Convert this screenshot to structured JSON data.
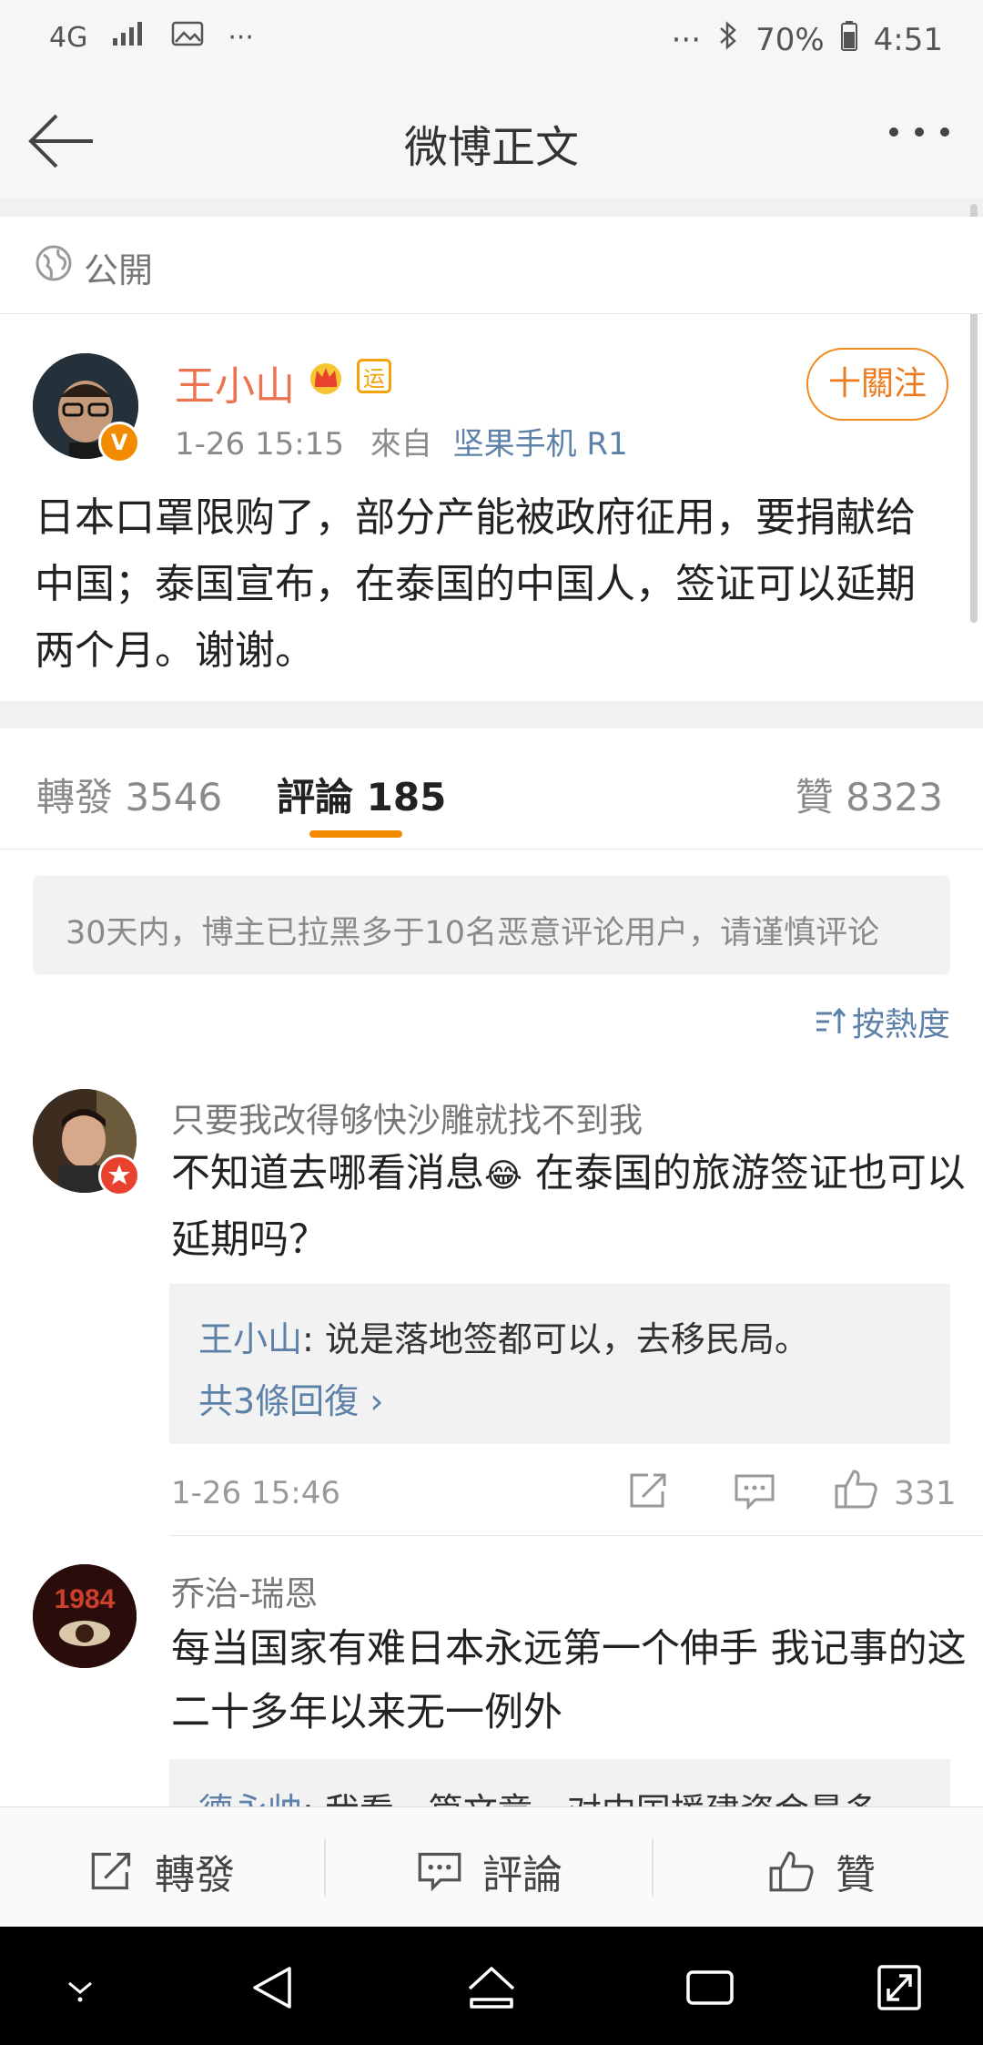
{
  "status_bar": {
    "network": "4G",
    "battery": "70%",
    "time": "4:51",
    "dots_left": "···",
    "dots_right": "···"
  },
  "nav": {
    "title": "微博正文"
  },
  "visibility": {
    "label": "公開"
  },
  "post": {
    "author": "王小山",
    "vip_badge": "运",
    "follow_label": "十關注",
    "time": "1-26 15:15",
    "source_prefix": "來自",
    "source": "坚果手机 R1",
    "text": "日本口罩限购了，部分产能被政府征用，要捐献给中国；泰国宣布，在泰国的中国人，签证可以延期两个月。谢谢。"
  },
  "tabs": {
    "repost": "轉發 3546",
    "comment": "評論 185",
    "like": "贊 8323"
  },
  "notice": "30天内，博主已拉黑多于10名恶意评论用户，请谨慎评论",
  "sort_label": "按熱度",
  "comments": [
    {
      "user": "只要我改得够快沙雕就找不到我",
      "text_before_emoji": "不知道去哪看消息",
      "emoji": "😂",
      "text_after_emoji": " 在泰国的旅游签证也可以延期吗？",
      "reply_user": "王小山",
      "reply_text": ": 说是落地签都可以，去移民局。",
      "reply_more": "共3條回復 ›",
      "time": "1-26 15:46",
      "likes": "331"
    },
    {
      "user": "乔治-瑞恩",
      "avatar_text": "1984",
      "text": "每当国家有难日本永远第一个伸手 我记事的这二十多年以来无一例外",
      "reply_user": "德永帅",
      "reply_text": ": 我看一篇文章，对中国援建资金最多"
    }
  ],
  "actions": {
    "repost": "轉發",
    "comment": "評論",
    "like": "贊"
  }
}
